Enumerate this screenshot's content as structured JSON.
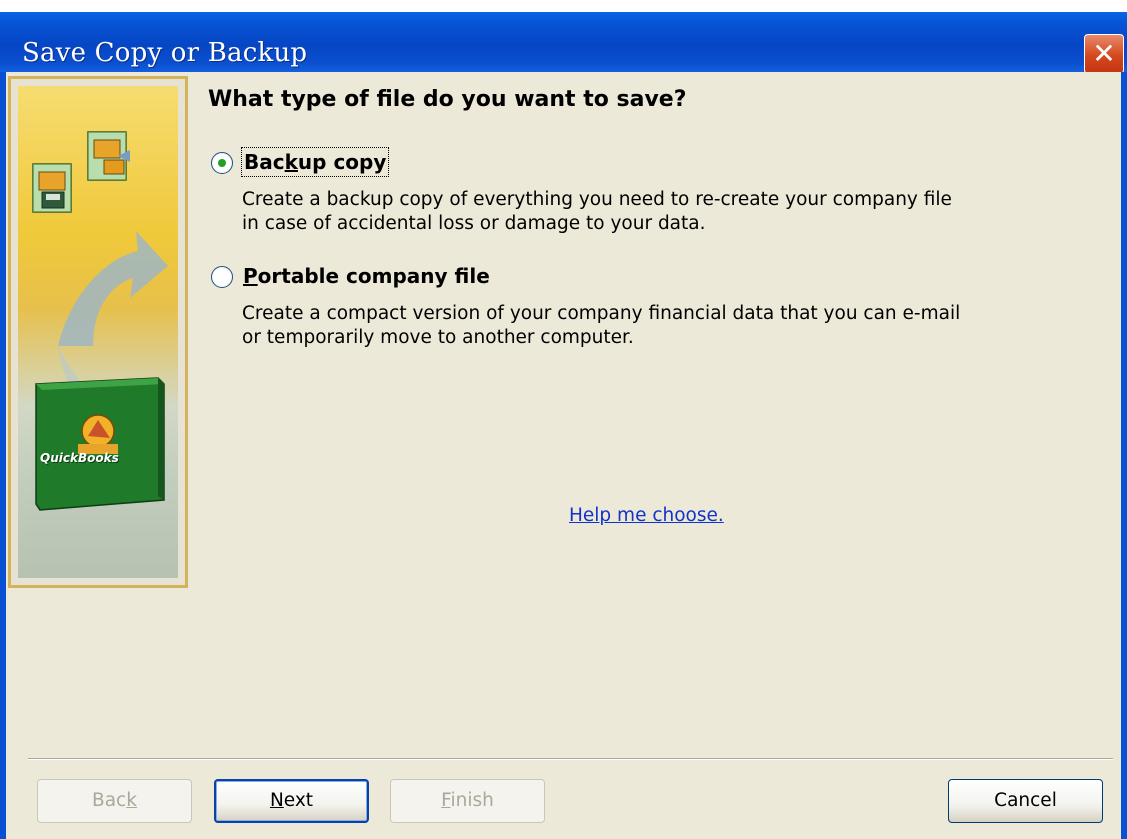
{
  "window": {
    "title": "Save Copy or Backup",
    "close_glyph": "✕"
  },
  "banner": {
    "icons": [
      "file-save-icon",
      "file-export-icon",
      "curved-arrow-icon",
      "quickbooks-box-icon"
    ],
    "box_label": "QuickBooks"
  },
  "main": {
    "heading": "What type of file do you want to save?",
    "options": [
      {
        "label_pre": "Bac",
        "label_access": "k",
        "label_post": "up copy",
        "selected": true,
        "description_lines": [
          "Create a backup copy of everything you need to re-create your company file",
          "in case of accidental loss or damage to your data."
        ]
      },
      {
        "label_pre": "",
        "label_access": "P",
        "label_post": "ortable company file",
        "selected": false,
        "description_lines": [
          "Create a compact version of your company financial data that you can e-mail",
          "or temporarily move to another computer."
        ]
      }
    ],
    "help_link": "Help me choose."
  },
  "footer": {
    "back": {
      "pre": "Bac",
      "access": "k",
      "post": "",
      "enabled": false
    },
    "next": {
      "pre": "",
      "access": "N",
      "post": "ext",
      "enabled": true
    },
    "finish": {
      "pre": "",
      "access": "F",
      "post": "inish",
      "enabled": false
    },
    "cancel": {
      "label": "Cancel",
      "enabled": true
    }
  },
  "colors": {
    "titlebar": "#0a50d4",
    "radio_dot": "#21a121",
    "link": "#1233c9",
    "banner_gold": "#f0c93a"
  }
}
